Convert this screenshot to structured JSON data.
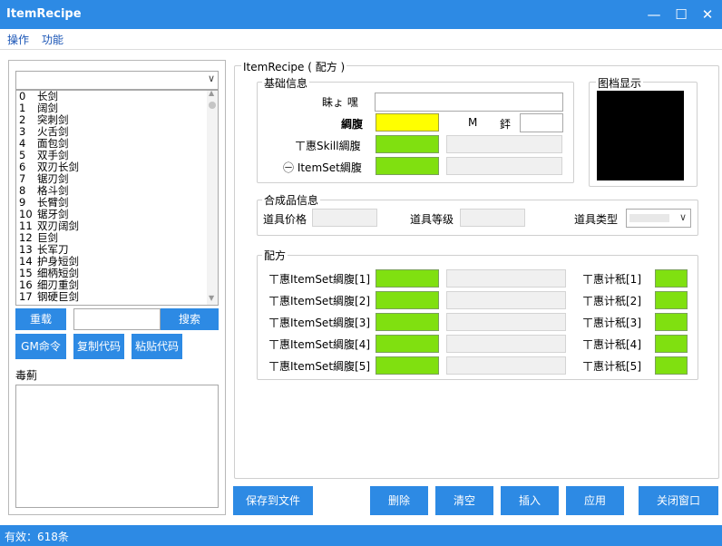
{
  "window": {
    "title": "ItemRecipe"
  },
  "menu": [
    "操作",
    "功能"
  ],
  "left": {
    "combo_value": "",
    "items": [
      {
        "idx": "0",
        "name": "长剑"
      },
      {
        "idx": "1",
        "name": "阔剑"
      },
      {
        "idx": "2",
        "name": "突刺剑"
      },
      {
        "idx": "3",
        "name": "火舌剑"
      },
      {
        "idx": "4",
        "name": "面包剑"
      },
      {
        "idx": "5",
        "name": "双手剑"
      },
      {
        "idx": "6",
        "name": "双刃长剑"
      },
      {
        "idx": "7",
        "name": "锯刃剑"
      },
      {
        "idx": "8",
        "name": "格斗剑"
      },
      {
        "idx": "9",
        "name": "长臂剑"
      },
      {
        "idx": "10",
        "name": "锯牙剑"
      },
      {
        "idx": "11",
        "name": "双刃阔剑"
      },
      {
        "idx": "12",
        "name": "巨剑"
      },
      {
        "idx": "13",
        "name": "长军刀"
      },
      {
        "idx": "14",
        "name": "护身短剑"
      },
      {
        "idx": "15",
        "name": "细柄短剑"
      },
      {
        "idx": "16",
        "name": "细刃重剑"
      },
      {
        "idx": "17",
        "name": "钢硬巨剑"
      }
    ],
    "reload_label": "重载",
    "search_value": "",
    "search_label": "搜索",
    "gm_label": "GM命令",
    "copy_label": "复制代码",
    "paste_label": "粘贴代码",
    "desc_label": "毒薊",
    "desc_value": ""
  },
  "main_group": "ItemRecipe ( 配方 )",
  "basic": {
    "title": "基础信息",
    "name_label": "眛ょ  嘿",
    "name_value": "",
    "code_label": "綢腹",
    "code_value": "",
    "m_label": "M",
    "count_label": "銔",
    "count_value": "",
    "skill_label": "ㄒ惠Skill綢腹",
    "skill_value": "",
    "skill_desc": "",
    "itemset_label": "㊀ ItemSet綢腹",
    "itemset_value": "",
    "itemset_desc": ""
  },
  "image_group": {
    "title": "图档显示"
  },
  "product": {
    "title": "合成品信息",
    "price_label": "道具价格",
    "price_value": "",
    "level_label": "道具等级",
    "level_value": "",
    "type_label": "道具类型"
  },
  "recipe": {
    "title": "配方",
    "rows": [
      {
        "label": "ㄒ惠ItemSet綢腹[1]",
        "value": "",
        "desc": "",
        "count_label": "ㄒ惠计秖[1]",
        "count_value": ""
      },
      {
        "label": "ㄒ惠ItemSet綢腹[2]",
        "value": "",
        "desc": "",
        "count_label": "ㄒ惠计秖[2]",
        "count_value": ""
      },
      {
        "label": "ㄒ惠ItemSet綢腹[3]",
        "value": "",
        "desc": "",
        "count_label": "ㄒ惠计秖[3]",
        "count_value": ""
      },
      {
        "label": "ㄒ惠ItemSet綢腹[4]",
        "value": "",
        "desc": "",
        "count_label": "ㄒ惠计秖[4]",
        "count_value": ""
      },
      {
        "label": "ㄒ惠ItemSet綢腹[5]",
        "value": "",
        "desc": "",
        "count_label": "ㄒ惠计秖[5]",
        "count_value": ""
      }
    ]
  },
  "buttons": {
    "save": "保存到文件",
    "delete": "删除",
    "clear": "清空",
    "insert": "插入",
    "apply": "应用",
    "close": "关闭窗口"
  },
  "status": {
    "text": "有效：618条"
  },
  "colors": {
    "accent": "#2d8ae4",
    "green": "#80e010",
    "yellow": "#ffff00"
  }
}
